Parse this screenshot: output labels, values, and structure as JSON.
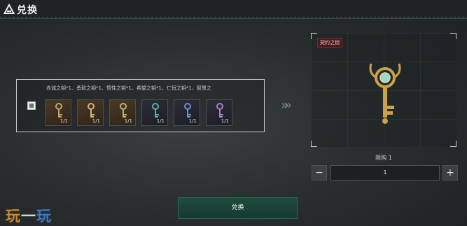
{
  "header": {
    "title": "兑换"
  },
  "exchange_list": {
    "items_text": "赤诚之钥*1、勇毅之钥*1、悟性之钥*1、希望之钥*1、仁恒之钥*1、智慧之",
    "slots": [
      {
        "tint": "gold",
        "gem_color": "#c8a36a",
        "qty": "1/1"
      },
      {
        "tint": "gold",
        "gem_color": "#d6b07a",
        "qty": "1/1"
      },
      {
        "tint": "gold",
        "gem_color": "#c9aa6e",
        "qty": "1/1"
      },
      {
        "tint": "dark",
        "gem_color": "#4fb3a8",
        "qty": "1/1"
      },
      {
        "tint": "dark",
        "gem_color": "#6c8fd0",
        "qty": "1/1"
      },
      {
        "tint": "dark",
        "gem_color": "#a684c8",
        "qty": "1/1"
      }
    ]
  },
  "arrows": "»",
  "preview": {
    "badge": "契约之钥"
  },
  "purchase": {
    "limit_text": "限购 1",
    "minus_label": "−",
    "plus_label": "+",
    "quantity": "1"
  },
  "action": {
    "exchange_label": "兑换"
  },
  "watermark": {
    "chars": [
      "玩",
      "一",
      "玩"
    ]
  },
  "colors": {
    "accent_green": "#1e4a3c",
    "badge_red": "#4a1b1d",
    "key_gold": "#c9a24a"
  }
}
